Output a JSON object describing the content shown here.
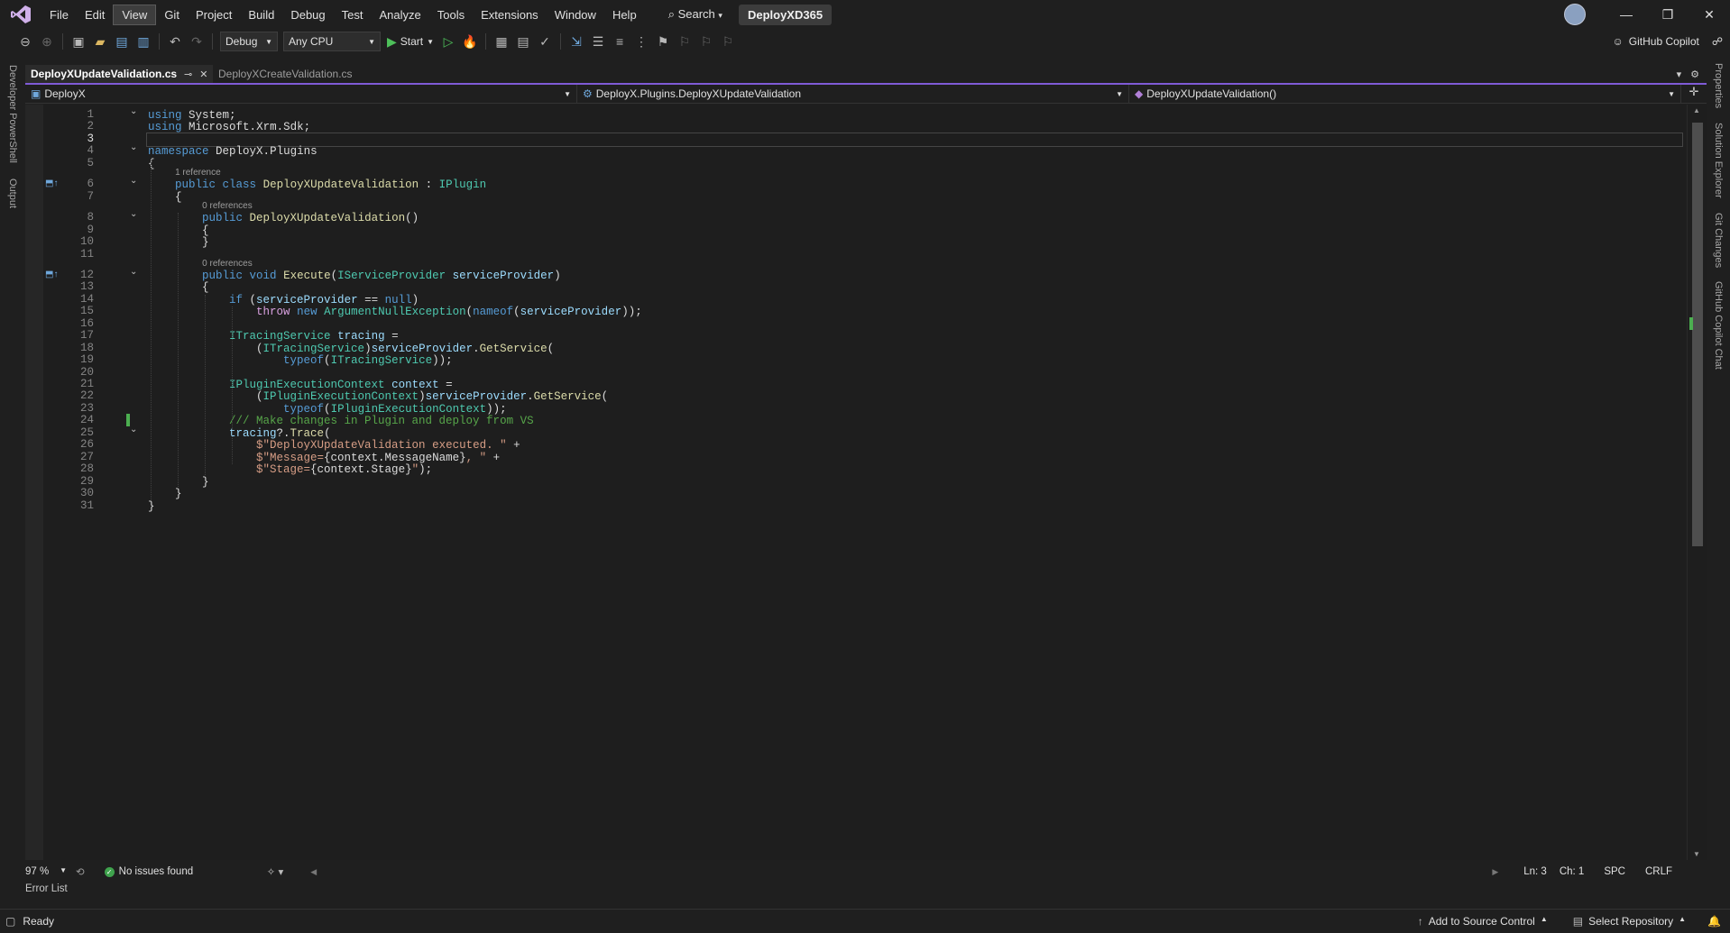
{
  "menu": {
    "items": [
      "File",
      "Edit",
      "View",
      "Git",
      "Project",
      "Build",
      "Debug",
      "Test",
      "Analyze",
      "Tools",
      "Extensions",
      "Window",
      "Help"
    ],
    "active": "View",
    "search_label": "Search",
    "project_name": "DeployXD365"
  },
  "toolbar": {
    "configuration": "Debug",
    "platform": "Any CPU",
    "start_label": "Start",
    "copilot_label": "GitHub Copilot"
  },
  "left_rail": {
    "items": [
      "Developer PowerShell",
      "Output"
    ]
  },
  "right_rail": {
    "items": [
      "Properties",
      "Solution Explorer",
      "Git Changes",
      "GitHub Copilot Chat"
    ]
  },
  "tabs": [
    {
      "label": "DeployXUpdateValidation.cs",
      "active": true
    },
    {
      "label": "DeployXCreateValidation.cs",
      "active": false
    }
  ],
  "navbar": {
    "project": "DeployX",
    "type": "DeployX.Plugins.DeployXUpdateValidation",
    "member": "DeployXUpdateValidation()"
  },
  "editor": {
    "current_line": 3,
    "reference_hints": [
      {
        "before_line": 6,
        "text": "1 reference"
      },
      {
        "before_line": 8,
        "text": "0 references"
      },
      {
        "before_line": 12,
        "text": "0 references"
      }
    ],
    "code_lines": [
      "using System;",
      "using Microsoft.Xrm.Sdk;",
      "",
      "namespace DeployX.Plugins",
      "{",
      "    public class DeployXUpdateValidation : IPlugin",
      "    {",
      "        public DeployXUpdateValidation()",
      "        {",
      "        }",
      "",
      "        public void Execute(IServiceProvider serviceProvider)",
      "        {",
      "            if (serviceProvider == null)",
      "                throw new ArgumentNullException(nameof(serviceProvider));",
      "",
      "            ITracingService tracing =",
      "                (ITracingService)serviceProvider.GetService(",
      "                    typeof(ITracingService));",
      "",
      "            IPluginExecutionContext context =",
      "                (IPluginExecutionContext)serviceProvider.GetService(",
      "                    typeof(IPluginExecutionContext));",
      "            /// Make changes in Plugin and deploy from VS",
      "            tracing?.Trace(",
      "                $\"DeployXUpdateValidation executed. \" +",
      "                $\"Message={context.MessageName}, \" +",
      "                $\"Stage={context.Stage}\");",
      "        }",
      "    }",
      "}"
    ]
  },
  "editor_status": {
    "zoom": "97 %",
    "issues": "No issues found",
    "line": "Ln: 3",
    "col": "Ch: 1",
    "whitespace": "SPC",
    "line_ending": "CRLF"
  },
  "error_list_label": "Error List",
  "status": {
    "ready": "Ready",
    "source_control": "Add to Source Control",
    "repository": "Select Repository"
  },
  "colors": {
    "accent": "#7f5bd6",
    "keyword": "#569cd6",
    "type": "#4ec9b0",
    "string": "#d69d85",
    "comment": "#57a64a",
    "change_marker": "#4caf50"
  }
}
